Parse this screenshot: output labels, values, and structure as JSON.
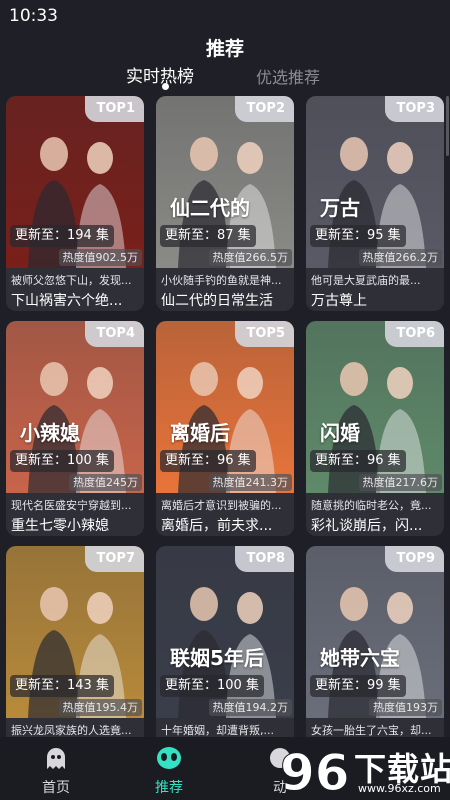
{
  "status": {
    "time": "10:33"
  },
  "header": {
    "title": "推荐"
  },
  "tabs": [
    {
      "label": "实时热榜",
      "active": true
    },
    {
      "label": "优选推荐",
      "active": false
    }
  ],
  "cards": [
    {
      "rank": "TOP1",
      "update": "更新至：194 集",
      "heat": "热度值902.5万",
      "desc": "被师父忽悠下山，发现...",
      "title": "下山祸害六个绝...",
      "poster_color": "#7a1f1a",
      "poster_text": ""
    },
    {
      "rank": "TOP2",
      "update": "更新至：87 集",
      "heat": "热度值266.5万",
      "desc": "小伙随手钓的鱼就是神...",
      "title": "仙二代的日常生活",
      "poster_color": "#8a8a86",
      "poster_text": "仙二代的"
    },
    {
      "rank": "TOP3",
      "update": "更新至：95 集",
      "heat": "热度值266.2万",
      "desc": "他可是大夏武庙的最...",
      "title": "万古尊上",
      "poster_color": "#5a5a66",
      "poster_text": "万古"
    },
    {
      "rank": "TOP4",
      "update": "更新至：100 集",
      "heat": "热度值245万",
      "desc": "现代名医盛安宁穿越到...",
      "title": "重生七零小辣媳",
      "poster_color": "#c8644a",
      "poster_text": "小辣媳"
    },
    {
      "rank": "TOP5",
      "update": "更新至：96 集",
      "heat": "热度值241.3万",
      "desc": "离婚后才意识到被骗的...",
      "title": "离婚后，前夫求...",
      "poster_color": "#e8743a",
      "poster_text": "离婚后"
    },
    {
      "rank": "TOP6",
      "update": "更新至：96 集",
      "heat": "热度值217.6万",
      "desc": "随意挑的临时老公，竟...",
      "title": "彩礼谈崩后，闪...",
      "poster_color": "#5f8a6a",
      "poster_text": "闪婚"
    },
    {
      "rank": "TOP7",
      "update": "更新至：143 集",
      "heat": "热度值195.4万",
      "desc": "振兴龙凤家族的人选竟...",
      "title": "",
      "poster_color": "#b88a3a",
      "poster_text": ""
    },
    {
      "rank": "TOP8",
      "update": "更新至：100 集",
      "heat": "热度值194.2万",
      "desc": "十年婚姻，却遭背叛,...",
      "title": "",
      "poster_color": "#3a3e4a",
      "poster_text": "联姻5年后"
    },
    {
      "rank": "TOP9",
      "update": "更新至：99 集",
      "heat": "热度值193万",
      "desc": "女孩一胎生了六宝，却...",
      "title": "",
      "poster_color": "#6a6e7a",
      "poster_text": "她带六宝"
    }
  ],
  "nav": [
    {
      "label": "首页",
      "icon": "ghost-icon"
    },
    {
      "label": "推荐",
      "icon": "alien-icon"
    },
    {
      "label": "动",
      "icon": "dynamic-icon"
    }
  ],
  "watermark": {
    "brand": "下载站",
    "url": "www.96xz.com",
    "number": "96"
  },
  "colors": {
    "accent": "#35e1c3",
    "background": "#1f2027",
    "card": "#2e2f37"
  }
}
